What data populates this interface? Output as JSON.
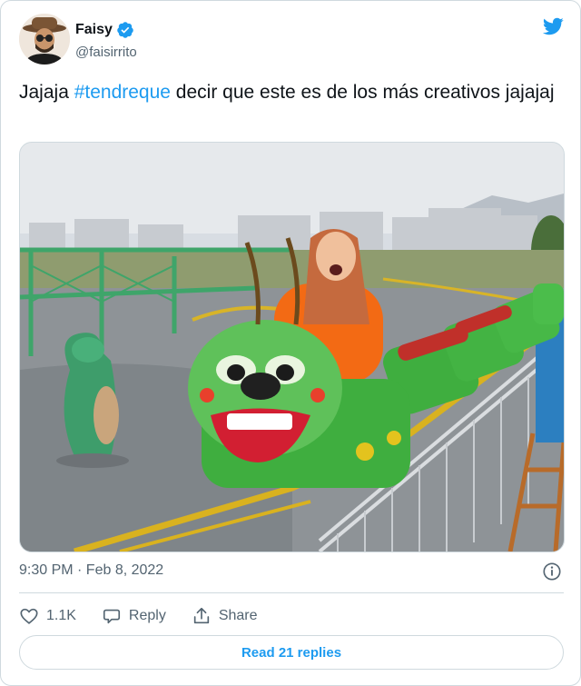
{
  "author": {
    "name": "Faisy",
    "handle": "@faisirrito",
    "verified": true
  },
  "tweet": {
    "text_before": "Jajaja ",
    "hashtag": "#tendreque",
    "text_after": " decir que este es de los más creativos jajajaj",
    "timestamp": "9:30 PM · Feb 8, 2022"
  },
  "media": {
    "description_icon": "photo"
  },
  "actions": {
    "like_count": "1.1K",
    "reply_label": "Reply",
    "share_label": "Share"
  },
  "read_replies_label": "Read 21 replies",
  "colors": {
    "accent": "#1d9bf0",
    "secondary_text": "#536471",
    "border": "#cfd9de"
  },
  "icons": {
    "brand": "twitter-bird-icon",
    "verified": "verified-badge-icon",
    "info": "info-icon",
    "like": "heart-icon",
    "reply": "reply-bubble-icon",
    "share": "share-icon"
  }
}
